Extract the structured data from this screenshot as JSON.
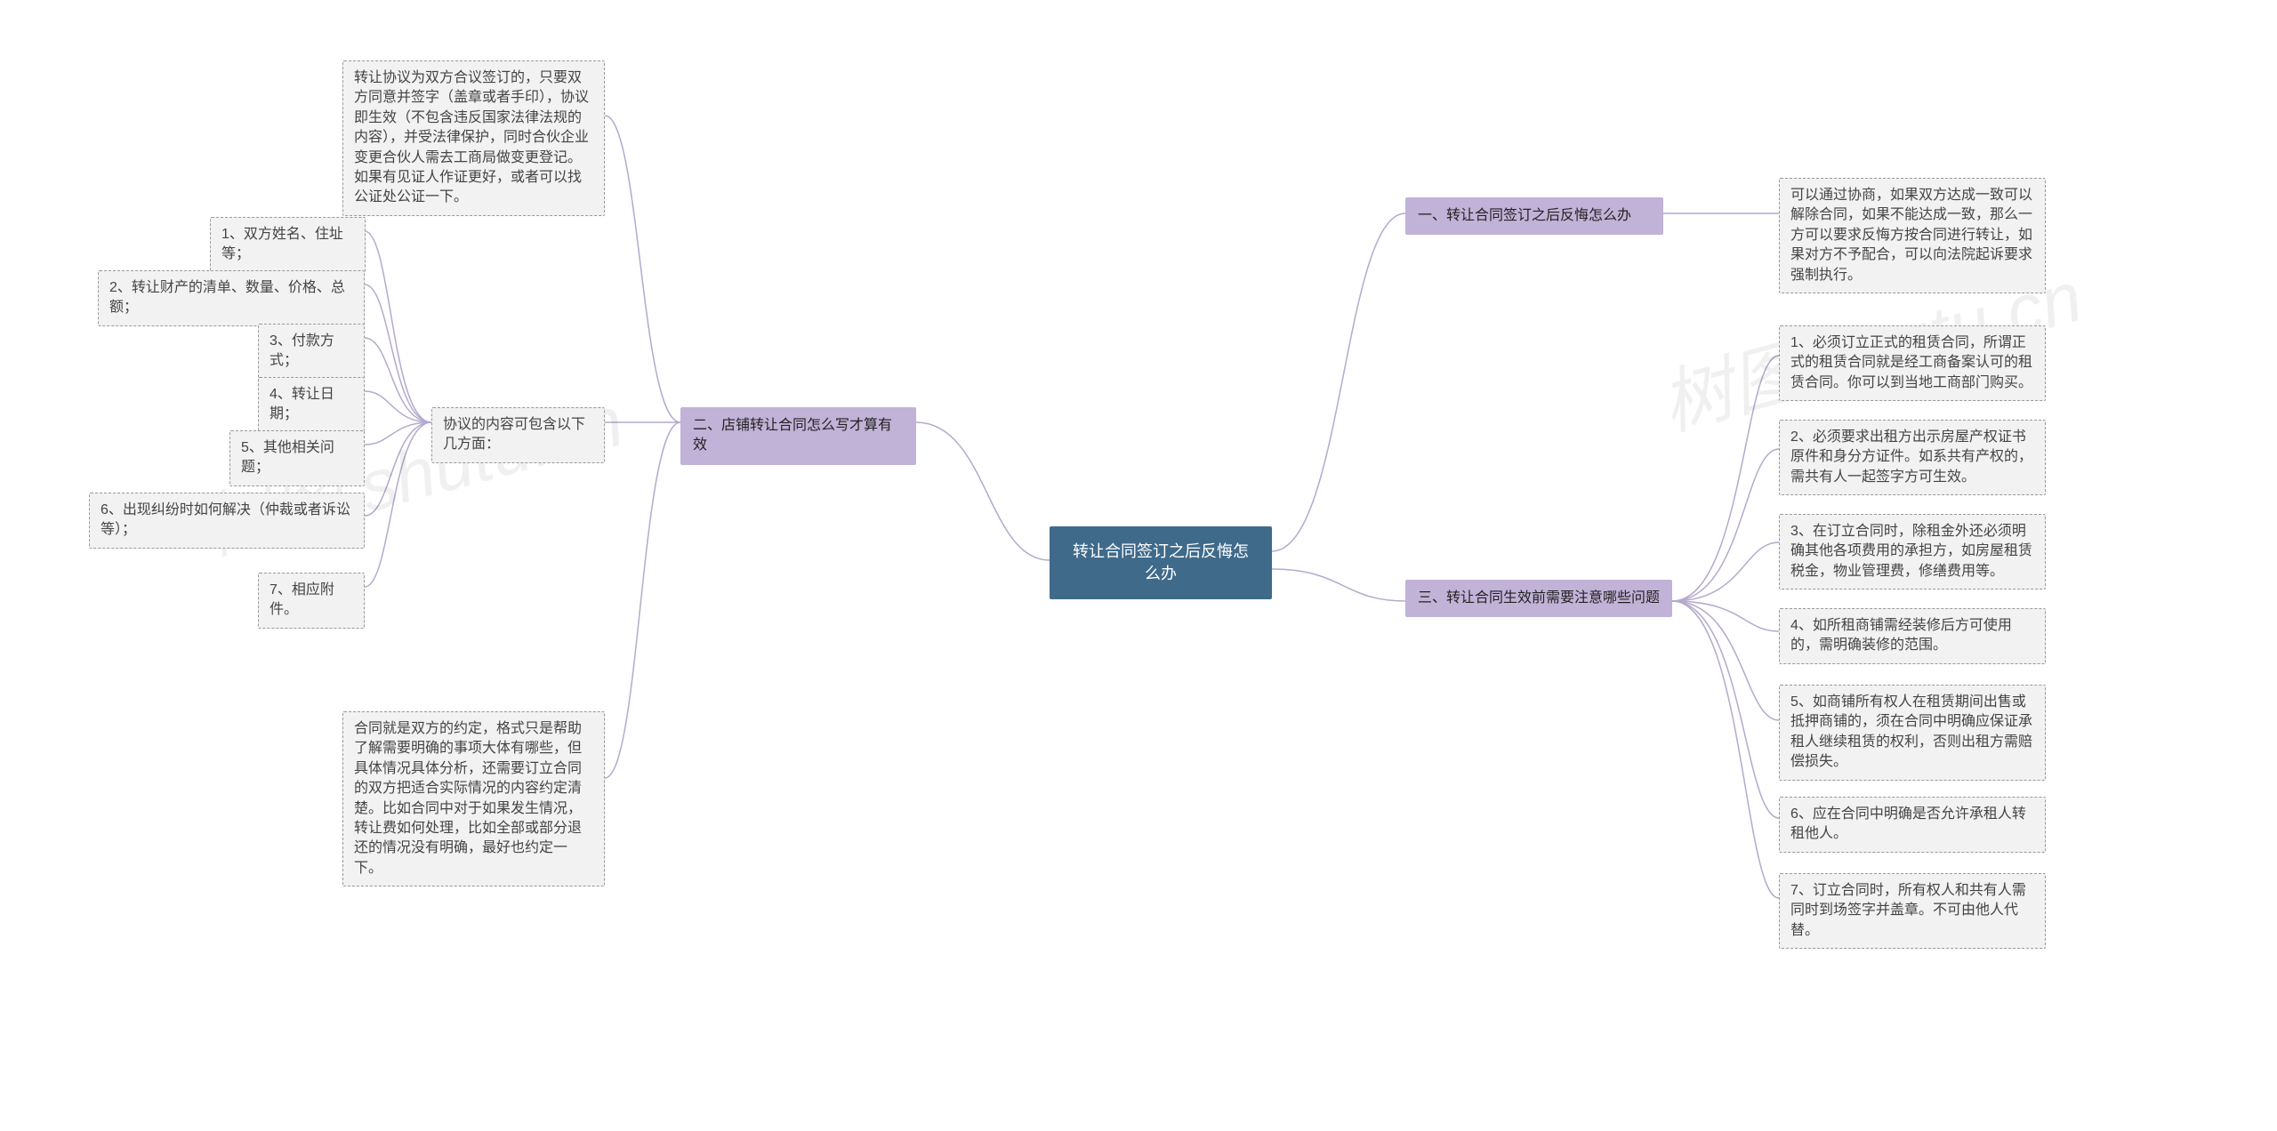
{
  "root": "转让合同签订之后反悔怎么办",
  "watermark": "树图 shutu.cn",
  "right": {
    "section1": {
      "title": "一、转让合同签订之后反悔怎么办",
      "item1": "可以通过协商，如果双方达成一致可以解除合同，如果不能达成一致，那么一方可以要求反悔方按合同进行转让，如果对方不予配合，可以向法院起诉要求强制执行。"
    },
    "section3": {
      "title": "三、转让合同生效前需要注意哪些问题",
      "item1": "1、必须订立正式的租赁合同，所谓正式的租赁合同就是经工商备案认可的租赁合同。你可以到当地工商部门购买。",
      "item2": "2、必须要求出租方出示房屋产权证书原件和身分方证件。如系共有产权的，需共有人一起签字方可生效。",
      "item3": "3、在订立合同时，除租金外还必须明确其他各项费用的承担方，如房屋租赁税金，物业管理费，修缮费用等。",
      "item4": "4、如所租商铺需经装修后方可使用的，需明确装修的范围。",
      "item5": "5、如商铺所有权人在租赁期间出售或抵押商铺的，须在合同中明确应保证承租人继续租赁的权利，否则出租方需赔偿损失。",
      "item6": "6、应在合同中明确是否允许承租人转租他人。",
      "item7": "7、订立合同时，所有权人和共有人需同时到场签字并盖章。不可由他人代替。"
    }
  },
  "left": {
    "section2": {
      "title": "二、店铺转让合同怎么写才算有效",
      "top": "转让协议为双方合议签订的，只要双方同意并签字（盖章或者手印），协议即生效（不包含违反国家法律法规的内容），并受法律保护，同时合伙企业变更合伙人需去工商局做变更登记。如果有见证人作证更好，或者可以找公证处公证一下。",
      "aspects": {
        "title": "协议的内容可包含以下几方面：",
        "item1": "1、双方姓名、住址等；",
        "item2": "2、转让财产的清单、数量、价格、总额；",
        "item3": "3、付款方式；",
        "item4": "4、转让日期；",
        "item5": "5、其他相关问题；",
        "item6": "6、出现纠纷时如何解决（仲裁或者诉讼等）；",
        "item7": "7、相应附件。"
      },
      "bottom": "合同就是双方的约定，格式只是帮助了解需要明确的事项大体有哪些，但具体情况具体分析，还需要订立合同的双方把适合实际情况的内容约定清楚。比如合同中对于如果发生情况，转让费如何处理，比如全部或部分退还的情况没有明确，最好也约定一下。"
    }
  }
}
